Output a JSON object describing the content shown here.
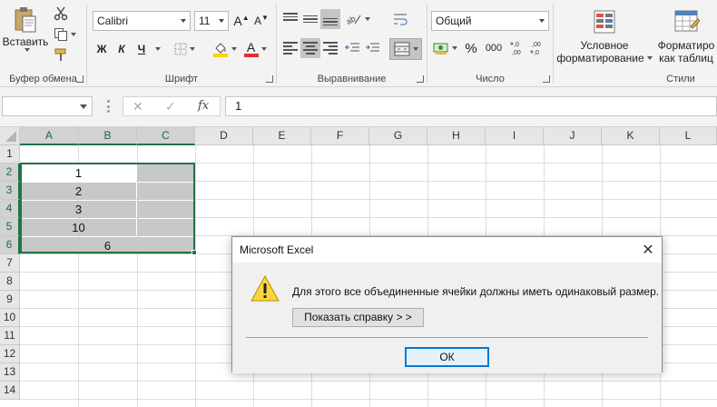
{
  "ribbon": {
    "clipboard": {
      "paste_label": "Вставить",
      "group_label": "Буфер обмена"
    },
    "font": {
      "name": "Calibri",
      "size": "11",
      "bold": "Ж",
      "italic": "К",
      "underline": "Ч",
      "color_letter": "А",
      "group_label": "Шрифт",
      "font_color": "#e03030",
      "fill_color": "#ffd200"
    },
    "alignment": {
      "group_label": "Выравнивание"
    },
    "number": {
      "format": "Общий",
      "percent": "%",
      "thousands": "000",
      "dec_inc": ",0\n,00",
      "dec_dec": ",00\n,0",
      "group_label": "Число"
    },
    "styles": {
      "conditional_line1": "Условное",
      "conditional_line2": "форматирование",
      "table_line1": "Форматиро",
      "table_line2": "как таблиц",
      "group_label": "Стили"
    }
  },
  "formula_bar": {
    "name_box": "",
    "cancel": "✕",
    "enter": "✓",
    "fx": "fx",
    "value": "1"
  },
  "sheet": {
    "columns": [
      "A",
      "B",
      "C",
      "D",
      "E",
      "F",
      "G",
      "H",
      "I",
      "J",
      "K",
      "L"
    ],
    "rows": [
      "1",
      "2",
      "3",
      "4",
      "5",
      "6",
      "7",
      "8",
      "9",
      "10",
      "11",
      "12",
      "13",
      "14"
    ],
    "cells": {
      "ab2": "1",
      "ab3": "2",
      "ab4": "3",
      "ab5": "10",
      "ac6": "6"
    },
    "selection_color": "#217346"
  },
  "dialog": {
    "title": "Microsoft Excel",
    "close": "✕",
    "message": "Для этого все объединенные ячейки должны иметь одинаковый размер.",
    "help_button": "Показать справку > >",
    "ok_button": "ОК",
    "icon": "warning-icon"
  }
}
